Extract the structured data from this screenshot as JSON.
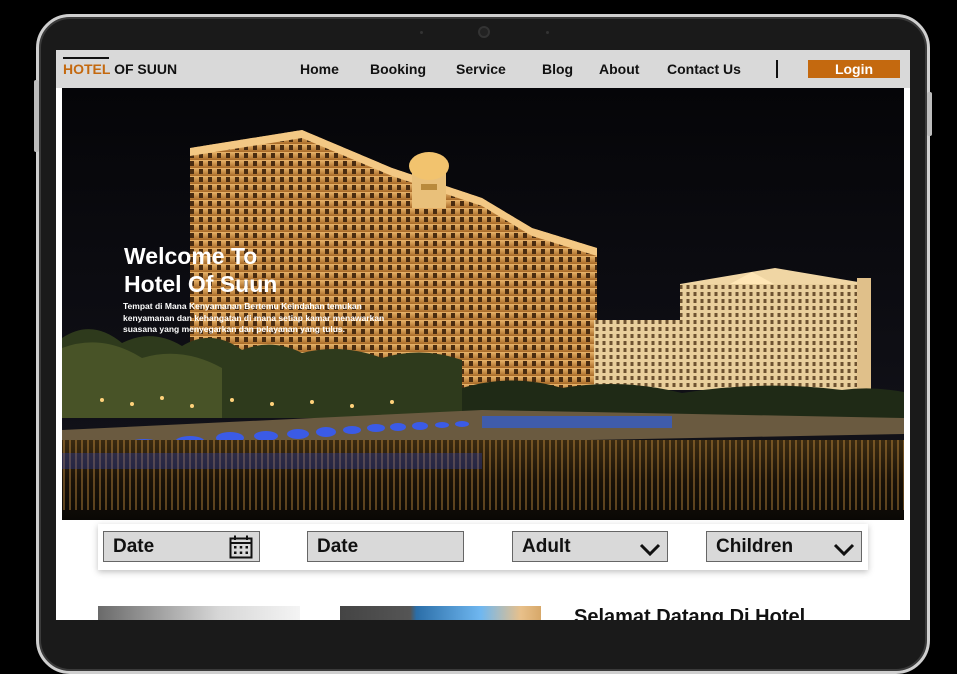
{
  "nav": {
    "brand_accent": "HOTEL",
    "brand_rest": " OF SUUN",
    "links": [
      "Home",
      "Booking",
      "Service",
      "Blog",
      "About",
      "Contact Us"
    ],
    "login": "Login"
  },
  "hero": {
    "title_line1": "Welcome To",
    "title_line2": "Hotel Of Suun",
    "text": "Tempat di Mana Kenyamanan Bertemu Keindahan temukan kenyamanan dan kehangatan di mana setiap kamar menawarkan suasana yang menyegarkan dan pelayanan yang tulus."
  },
  "booking": {
    "checkin": "Date",
    "checkout": "Date",
    "adult": "Adult",
    "children": "Children"
  },
  "section": {
    "welcome_heading": "Selamat Datang Di Hotel"
  },
  "colors": {
    "accent": "#c4690f",
    "nav_bg": "#d9d9d9"
  }
}
